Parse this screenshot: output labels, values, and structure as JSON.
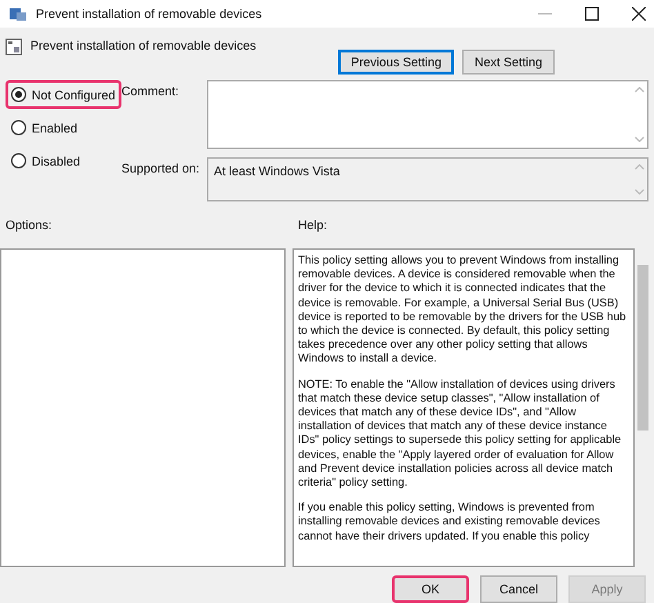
{
  "window": {
    "title": "Prevent installation of removable devices"
  },
  "heading": "Prevent installation of removable devices",
  "nav_buttons": [
    "Previous Setting",
    "Next Setting"
  ],
  "state_options": [
    {
      "label": "Not Configured",
      "selected": true,
      "highlighted": true
    },
    {
      "label": "Enabled",
      "selected": false,
      "highlighted": false
    },
    {
      "label": "Disabled",
      "selected": false,
      "highlighted": false
    }
  ],
  "comment": {
    "label": "Comment:"
  },
  "supported_on": {
    "label": "Supported on:",
    "value": "At least Windows Vista"
  },
  "options": {
    "label": "Options:"
  },
  "help": {
    "label": "Help:",
    "paragraphs": [
      "This policy setting allows you to prevent Windows from installing removable devices. A device is considered removable when the driver for the device to which it is connected indicates that the device is removable. For example, a Universal Serial Bus (USB) device is reported to be removable by the drivers for the USB hub to which the device is connected. By default, this policy setting takes precedence over any other policy setting that allows Windows to install a device.",
      "NOTE: To enable the \"Allow installation of devices using drivers that match these device setup classes\", \"Allow installation of devices that match any of these device IDs\", and \"Allow installation of devices that match any of these device instance IDs\" policy settings to supersede this policy setting for applicable devices, enable the \"Apply layered order of evaluation for Allow and Prevent device installation policies across all device match criteria\" policy setting.",
      "If you enable this policy setting, Windows is prevented from installing removable devices and existing removable devices cannot have their drivers updated. If you enable this policy"
    ]
  },
  "buttons": [
    {
      "label": "OK",
      "disabled": false,
      "highlighted": true
    },
    {
      "label": "Cancel",
      "disabled": false,
      "highlighted": false
    },
    {
      "label": "Apply",
      "disabled": true,
      "highlighted": false
    }
  ]
}
